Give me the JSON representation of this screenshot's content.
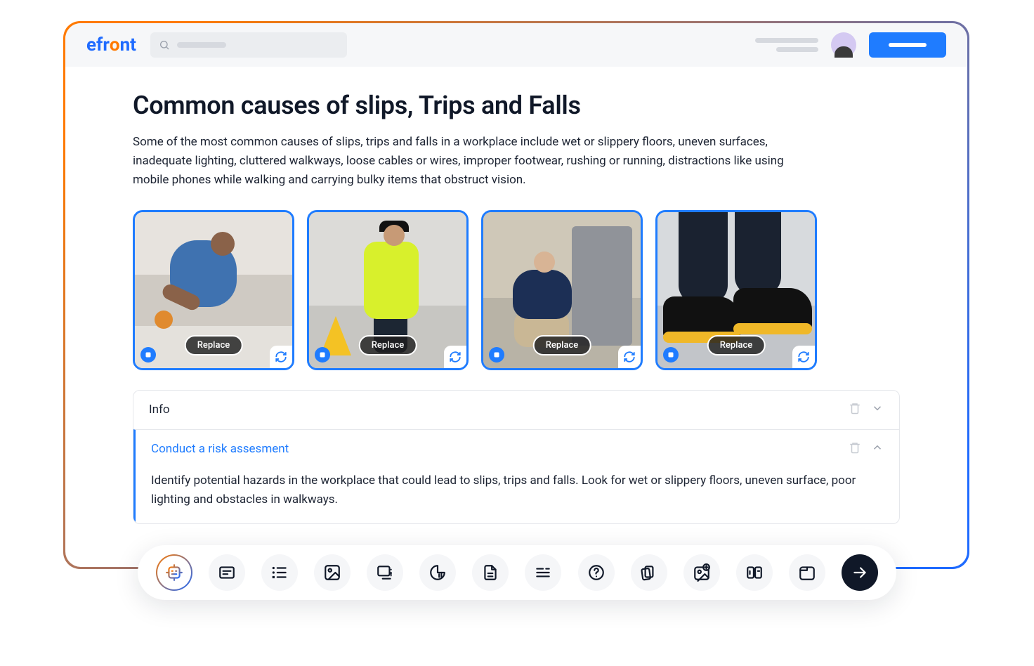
{
  "logo": {
    "text_a": "efr",
    "text_o": "o",
    "text_b": "nt"
  },
  "page": {
    "title": "Common causes of slips, Trips and Falls",
    "intro": "Some of the most common causes of slips, trips and falls in a workplace include wet or slippery floors, uneven surfaces, inadequate lighting, cluttered walkways, loose cables or wires, improper footwear, rushing or running, distractions like using mobile phones while walking and carrying bulky items that obstruct vision."
  },
  "cards": {
    "replace_label": "Replace"
  },
  "accordion": {
    "item1": {
      "title": "Info"
    },
    "item2": {
      "title": "Conduct a risk assesment",
      "body": "Identify potential hazards in the workplace that could lead to slips, trips and falls. Look for wet or slippery floors, uneven surface, poor lighting and obstacles in walkways."
    }
  }
}
